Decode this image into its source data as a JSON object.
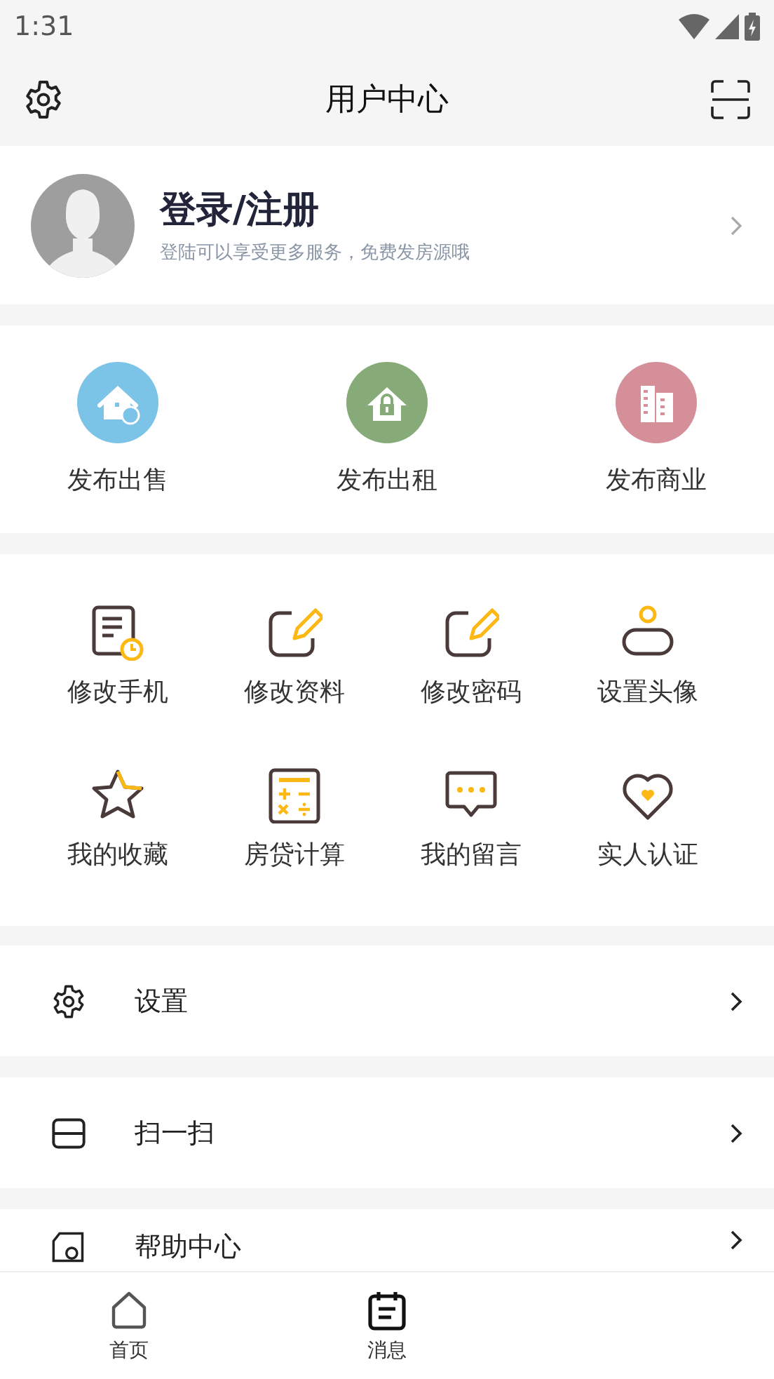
{
  "status_bar": {
    "time": "1:31"
  },
  "header": {
    "title": "用户中心"
  },
  "profile": {
    "title": "登录/注册",
    "subtitle": "登陆可以享受更多服务，免费发房源哦"
  },
  "publish": [
    {
      "label": "发布出售",
      "kind": "sale",
      "color": "#7cc3e8"
    },
    {
      "label": "发布出租",
      "kind": "rent",
      "color": "#86ab78"
    },
    {
      "label": "发布商业",
      "kind": "business",
      "color": "#d58f99"
    }
  ],
  "tools": [
    {
      "label": "修改手机",
      "kind": "phone"
    },
    {
      "label": "修改资料",
      "kind": "edit"
    },
    {
      "label": "修改密码",
      "kind": "edit"
    },
    {
      "label": "设置头像",
      "kind": "avatar"
    },
    {
      "label": "我的收藏",
      "kind": "star"
    },
    {
      "label": "房贷计算",
      "kind": "calculator"
    },
    {
      "label": "我的留言",
      "kind": "message"
    },
    {
      "label": "实人认证",
      "kind": "heart"
    }
  ],
  "menu": [
    {
      "label": "设置",
      "kind": "settings"
    },
    {
      "label": "扫一扫",
      "kind": "scan"
    },
    {
      "label": "帮助中心",
      "kind": "help"
    }
  ],
  "tab_bar": [
    {
      "label": "首页",
      "kind": "home",
      "selected": false
    },
    {
      "label": "消息",
      "kind": "messages",
      "selected": false
    }
  ]
}
